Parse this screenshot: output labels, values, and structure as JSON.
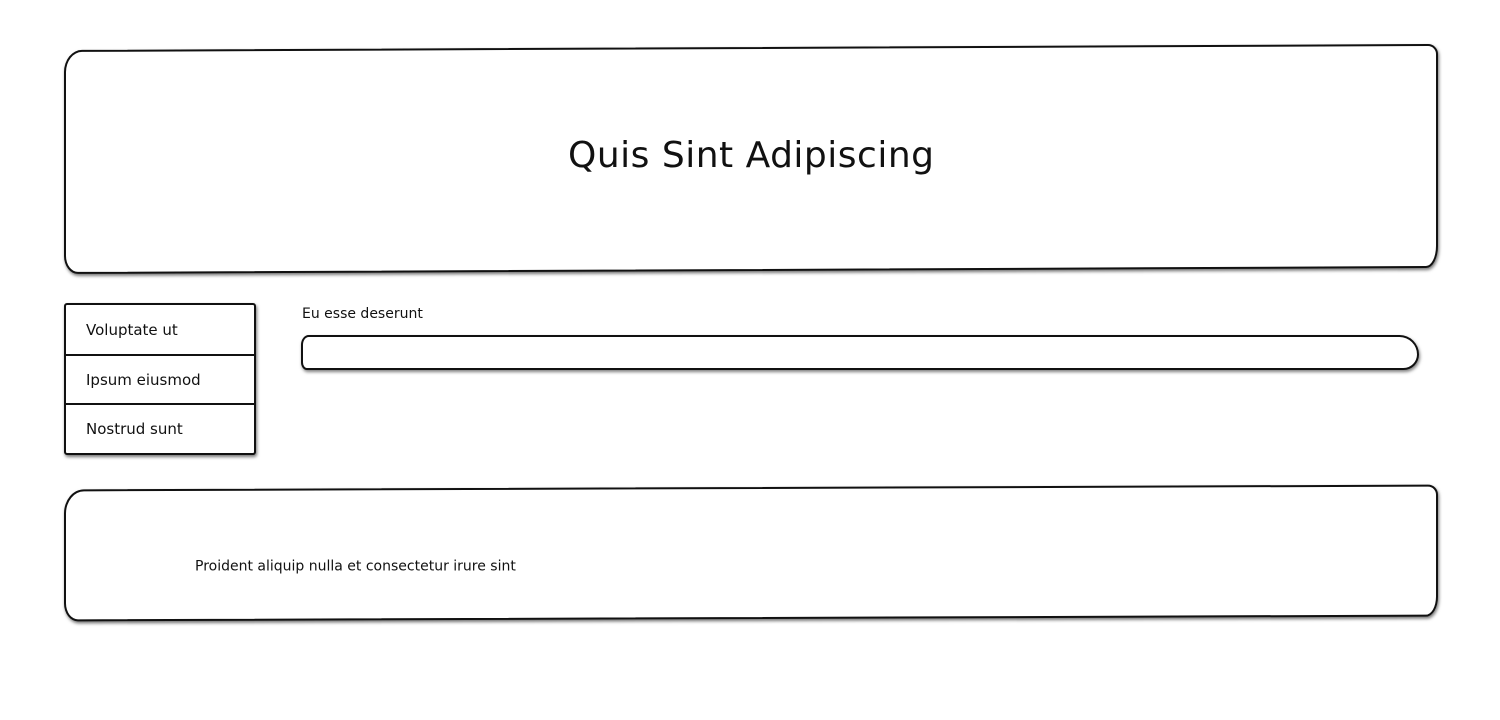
{
  "header": {
    "title": "Quis Sint Adipiscing"
  },
  "sidebar": {
    "items": [
      {
        "label": "Voluptate ut"
      },
      {
        "label": "Ipsum eiusmod"
      },
      {
        "label": "Nostrud sunt"
      }
    ]
  },
  "form": {
    "field_label": "Eu esse deserunt",
    "field_value": "",
    "field_placeholder": ""
  },
  "footer": {
    "text": "Proident aliquip nulla et consectetur irure sint"
  }
}
